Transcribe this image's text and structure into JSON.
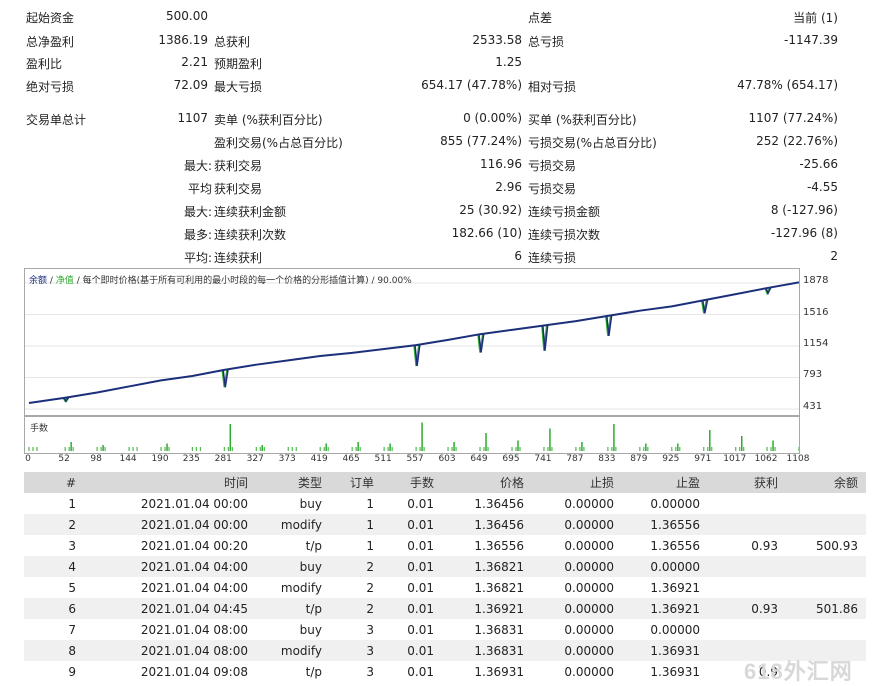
{
  "stats": [
    {
      "l1": "起始资金",
      "v1": "500.00",
      "l2": "",
      "v2": "",
      "l3": "点差",
      "v3": "当前 (1)"
    },
    {
      "l1": "总净盈利",
      "v1": "1386.19",
      "l2": "总获利",
      "v2": "2533.58",
      "l3": "总亏损",
      "v3": "-1147.39"
    },
    {
      "l1": "盈利比",
      "v1": "2.21",
      "l2": "预期盈利",
      "v2": "1.25",
      "l3": "",
      "v3": ""
    },
    {
      "l1": "绝对亏损",
      "v1": "72.09",
      "l2": "最大亏损",
      "v2": "654.17 (47.78%)",
      "l3": "相对亏损",
      "v3": "47.78% (654.17)"
    },
    {
      "l1": "交易单总计",
      "v1": "1107",
      "l2": "卖单 (%获利百分比)",
      "v2": "0 (0.00%)",
      "l3": "买单 (%获利百分比)",
      "v3": "1107 (77.24%)"
    },
    {
      "p": "",
      "l2": "盈利交易(%占总百分比)",
      "v2": "855 (77.24%)",
      "l3": "亏损交易(%占总百分比)",
      "v3": "252 (22.76%)"
    },
    {
      "p": "最大:",
      "l2": "获利交易",
      "v2": "116.96",
      "l3": "亏损交易",
      "v3": "-25.66"
    },
    {
      "p": "平均",
      "l2": "获利交易",
      "v2": "2.96",
      "l3": "亏损交易",
      "v3": "-4.55"
    },
    {
      "p": "最大:",
      "l2": "连续获利金额",
      "v2": "25 (30.92)",
      "l3": "连续亏损金额",
      "v3": "8 (-127.96)"
    },
    {
      "p": "最多:",
      "l2": "连续获利次数",
      "v2": "182.66 (10)",
      "l3": "连续亏损次数",
      "v3": "-127.96 (8)"
    },
    {
      "p": "平均:",
      "l2": "连续获利",
      "v2": "6",
      "l3": "连续亏损",
      "v3": "2"
    }
  ],
  "chart_legend": {
    "balance": "余额",
    "equity": "净值",
    "description": "每个即时价格(基于所有可利用的最小时段的每一个价格的分形插值计算)",
    "quality": "90.00%"
  },
  "volume_label": "手数",
  "chart_data": {
    "type": "line",
    "title": "",
    "xlabel": "",
    "ylabel": "",
    "x_ticks": [
      "0",
      "52",
      "98",
      "144",
      "190",
      "235",
      "281",
      "327",
      "373",
      "419",
      "465",
      "511",
      "557",
      "603",
      "649",
      "695",
      "741",
      "787",
      "833",
      "879",
      "925",
      "971",
      "1017",
      "1062",
      "1108"
    ],
    "y_ticks": [
      "1878",
      "1516",
      "1154",
      "793",
      "431"
    ],
    "xlim": [
      0,
      1108
    ],
    "ylim": [
      431,
      1878
    ],
    "series": [
      {
        "name": "余额",
        "color": "#1c2f7a",
        "x": [
          0,
          52,
          98,
          144,
          190,
          235,
          281,
          327,
          373,
          419,
          465,
          511,
          557,
          603,
          649,
          695,
          741,
          787,
          833,
          879,
          925,
          971,
          1017,
          1062,
          1108
        ],
        "y": [
          500,
          560,
          620,
          690,
          760,
          810,
          880,
          940,
          990,
          1040,
          1075,
          1120,
          1165,
          1225,
          1290,
          1340,
          1390,
          1440,
          1500,
          1560,
          1610,
          1680,
          1750,
          1820,
          1886
        ]
      },
      {
        "name": "净值",
        "color": "#2eaa2e",
        "dips": [
          [
            52,
            40
          ],
          [
            281,
            200
          ],
          [
            557,
            240
          ],
          [
            649,
            210
          ],
          [
            741,
            290
          ],
          [
            833,
            230
          ],
          [
            971,
            150
          ],
          [
            1062,
            60
          ]
        ]
      }
    ],
    "volume_spikes": [
      [
        52,
        0.3
      ],
      [
        98,
        0.2
      ],
      [
        190,
        0.25
      ],
      [
        281,
        0.9
      ],
      [
        327,
        0.2
      ],
      [
        419,
        0.25
      ],
      [
        465,
        0.3
      ],
      [
        511,
        0.25
      ],
      [
        557,
        0.95
      ],
      [
        603,
        0.3
      ],
      [
        649,
        0.6
      ],
      [
        695,
        0.35
      ],
      [
        741,
        0.75
      ],
      [
        787,
        0.3
      ],
      [
        833,
        0.9
      ],
      [
        879,
        0.25
      ],
      [
        925,
        0.25
      ],
      [
        971,
        0.7
      ],
      [
        1017,
        0.5
      ],
      [
        1062,
        0.35
      ],
      [
        1108,
        0.3
      ]
    ]
  },
  "trade_table": {
    "headers": [
      "#",
      "时间",
      "类型",
      "订单",
      "手数",
      "价格",
      "止损",
      "止盈",
      "获利",
      "余额"
    ],
    "rows": [
      [
        "1",
        "2021.01.04 00:00",
        "buy",
        "1",
        "0.01",
        "1.36456",
        "0.00000",
        "0.00000",
        "",
        ""
      ],
      [
        "2",
        "2021.01.04 00:00",
        "modify",
        "1",
        "0.01",
        "1.36456",
        "0.00000",
        "1.36556",
        "",
        ""
      ],
      [
        "3",
        "2021.01.04 00:20",
        "t/p",
        "1",
        "0.01",
        "1.36556",
        "0.00000",
        "1.36556",
        "0.93",
        "500.93"
      ],
      [
        "4",
        "2021.01.04 04:00",
        "buy",
        "2",
        "0.01",
        "1.36821",
        "0.00000",
        "0.00000",
        "",
        ""
      ],
      [
        "5",
        "2021.01.04 04:00",
        "modify",
        "2",
        "0.01",
        "1.36821",
        "0.00000",
        "1.36921",
        "",
        ""
      ],
      [
        "6",
        "2021.01.04 04:45",
        "t/p",
        "2",
        "0.01",
        "1.36921",
        "0.00000",
        "1.36921",
        "0.93",
        "501.86"
      ],
      [
        "7",
        "2021.01.04 08:00",
        "buy",
        "3",
        "0.01",
        "1.36831",
        "0.00000",
        "0.00000",
        "",
        ""
      ],
      [
        "8",
        "2021.01.04 08:00",
        "modify",
        "3",
        "0.01",
        "1.36831",
        "0.00000",
        "1.36931",
        "",
        ""
      ],
      [
        "9",
        "2021.01.04 09:08",
        "t/p",
        "3",
        "0.01",
        "1.36931",
        "0.00000",
        "1.36931",
        "0.9",
        ""
      ]
    ]
  },
  "watermark": "618外汇网"
}
